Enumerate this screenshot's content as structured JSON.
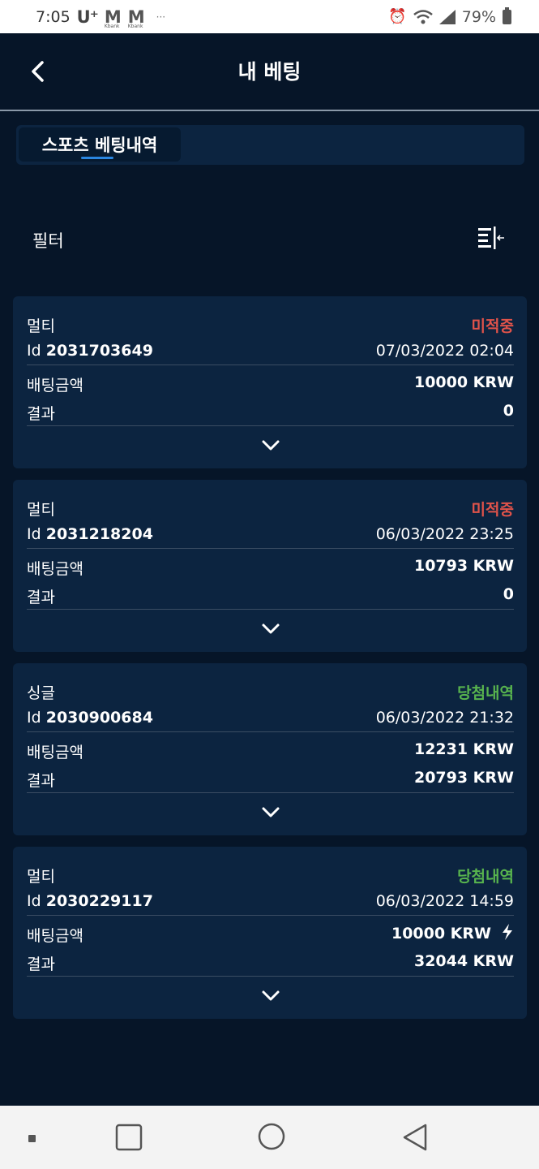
{
  "status_bar": {
    "time": "7:05",
    "carrier": "U⁺",
    "app1": "M",
    "app1_sub": "Kbank",
    "app2": "M",
    "app2_sub": "Kbank",
    "more": "···",
    "battery": "79%"
  },
  "header": {
    "title": "내 베팅"
  },
  "tabs": [
    {
      "label": "스포츠 베팅내역",
      "active": true
    }
  ],
  "filter": {
    "label": "필터"
  },
  "cards": [
    {
      "type": "멀티",
      "status": "미적중",
      "id_label": "Id",
      "id": "2031703649",
      "date": "07/03/2022 02:04",
      "amount_label": "배팅금액",
      "amount": "10000 KRW",
      "result_label": "결과",
      "result": "0"
    },
    {
      "type": "멀티",
      "status": "미적중",
      "id_label": "Id",
      "id": "2031218204",
      "date": "06/03/2022 23:25",
      "amount_label": "배팅금액",
      "amount": "10793 KRW",
      "result_label": "결과",
      "result": "0"
    },
    {
      "type": "싱글",
      "status": "당첨내역",
      "id_label": "Id",
      "id": "2030900684",
      "date": "06/03/2022 21:32",
      "amount_label": "배팅금액",
      "amount": "12231 KRW",
      "result_label": "결과",
      "result": "20793 KRW"
    },
    {
      "type": "멀티",
      "status": "당첨내역",
      "id_label": "Id",
      "id": "2030229117",
      "date": "06/03/2022 14:59",
      "amount_label": "배팅금액",
      "amount": "10000 KRW",
      "result_label": "결과",
      "result": "32044 KRW"
    }
  ],
  "colors": {
    "background": "#061528",
    "card": "#0c2440",
    "lost": "#e0534a",
    "won": "#58b44e",
    "accent": "#2a86e0"
  },
  "icons": [
    "back-chevron-icon",
    "filter-icon",
    "chevron-down-icon",
    "lightning-icon",
    "alarm-icon",
    "wifi-icon",
    "signal-icon",
    "battery-icon"
  ]
}
